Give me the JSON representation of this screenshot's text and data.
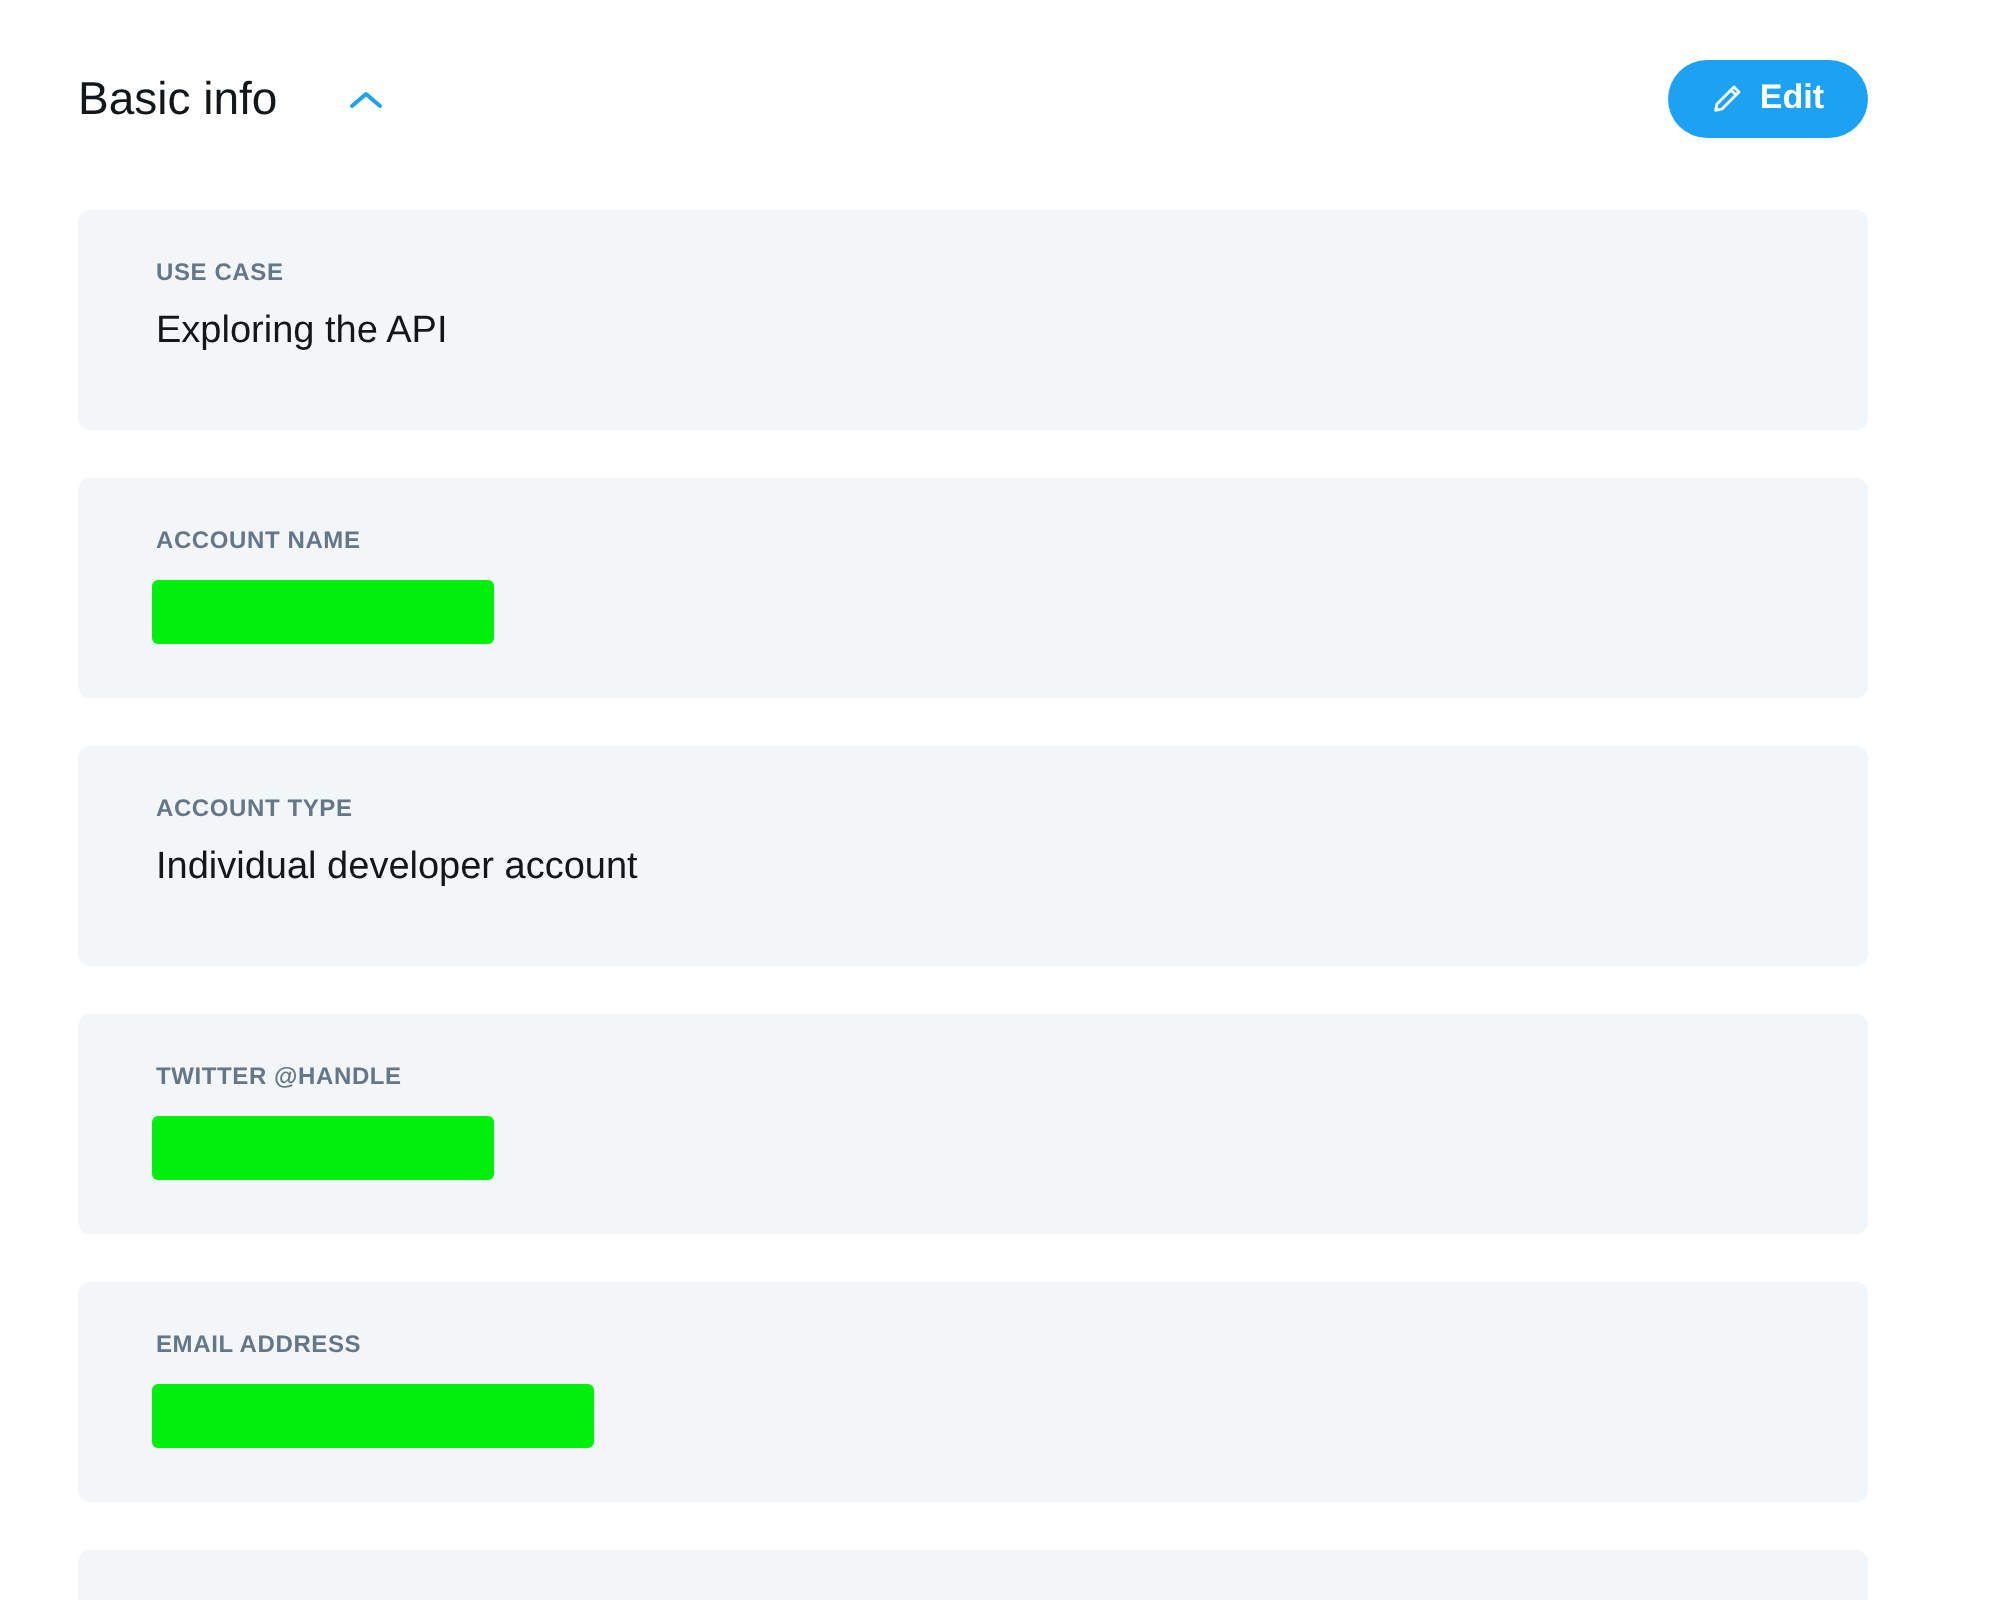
{
  "section": {
    "title": "Basic info",
    "expanded": true,
    "edit_button": "Edit"
  },
  "fields": [
    {
      "kind": "field",
      "label": "USE CASE",
      "value": "Exploring the API",
      "redacted": false
    },
    {
      "kind": "field",
      "label": "ACCOUNT NAME",
      "redacted": true
    },
    {
      "kind": "field",
      "label": "ACCOUNT TYPE",
      "value": "Individual developer account",
      "redacted": false
    },
    {
      "kind": "field",
      "label": "TWITTER @HANDLE",
      "redacted": true
    },
    {
      "kind": "field",
      "label": "EMAIL ADDRESS",
      "redacted": true,
      "wide": true
    },
    {
      "kind": "cut-off"
    }
  ]
}
